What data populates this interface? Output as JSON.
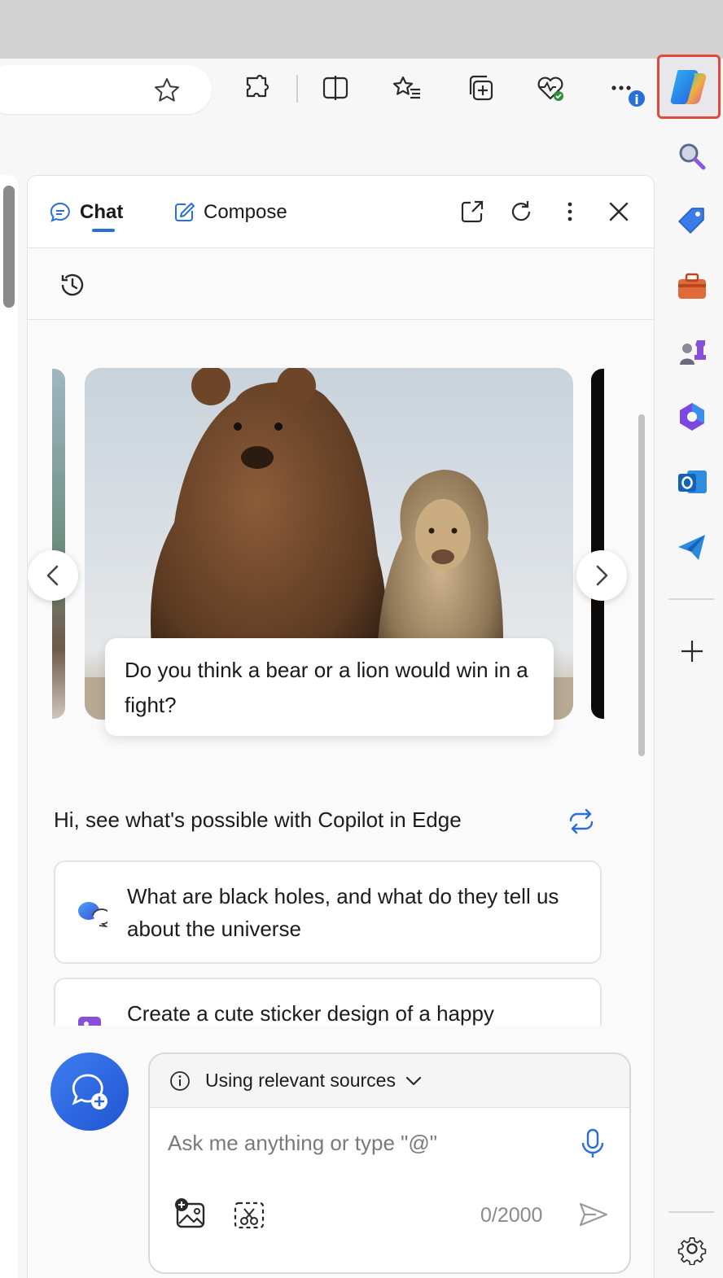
{
  "browser": {
    "toolbar_icons": [
      "star-icon",
      "extensions-icon",
      "split-screen-icon",
      "favorites-icon",
      "collections-icon",
      "browser-essentials-icon",
      "more-icon",
      "copilot-icon"
    ],
    "notification_badge": "i",
    "highlight_color": "#e04a3a"
  },
  "panel": {
    "tabs": [
      {
        "label": "Chat",
        "active": true,
        "icon": "chat-bubble-icon"
      },
      {
        "label": "Compose",
        "active": false,
        "icon": "compose-pen-icon"
      }
    ],
    "header_actions": [
      "open-in-new-window-icon",
      "refresh-icon",
      "more-options-icon",
      "close-icon"
    ],
    "history_icon": "history-icon"
  },
  "carousel": {
    "image_subject": "bear and lion",
    "prompt": "Do you think a bear or a lion would win in a fight?"
  },
  "greeting": "Hi, see what's possible with Copilot in Edge",
  "suggestions": [
    {
      "text": "What are black holes, and what do they tell us about the universe",
      "icon": "chat-bubbles-icon"
    },
    {
      "text": "Create a cute sticker design of a happy",
      "icon": "image-create-icon"
    }
  ],
  "composer": {
    "sources_label": "Using relevant sources",
    "placeholder": "Ask me anything or type \"@\"",
    "counter": "0/2000",
    "accent": "#2a6fd6"
  },
  "sidebar": {
    "items": [
      "search-icon",
      "shopping-tag-icon",
      "tools-icon",
      "games-icon",
      "microsoft-365-icon",
      "outlook-icon",
      "send-icon",
      "add-icon",
      "settings-icon"
    ]
  }
}
